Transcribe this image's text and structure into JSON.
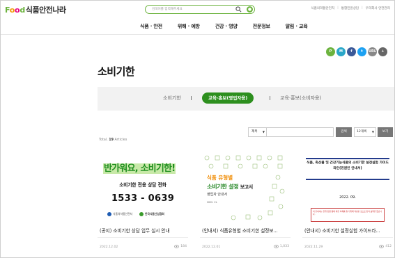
{
  "header": {
    "logo_food": "Food",
    "logo_site": "식품안전나라",
    "search_placeholder": "검색어를 입력해주세요",
    "top_links": [
      "식품의약품안전처",
      "통합민원상담",
      "우리회사 안전관리"
    ],
    "nav": [
      "식품 · 안전",
      "위해 · 예방",
      "건강 · 영양",
      "전문정보",
      "알림 · 교육"
    ]
  },
  "share": [
    "P",
    "M",
    "f",
    "t",
    "URL",
    "+"
  ],
  "page_title": "소비기한",
  "tabs": {
    "items": [
      "소비기한",
      "교육·홍보(영업자용)",
      "교육·홍보(소비자용)"
    ],
    "active_index": 1
  },
  "filter": {
    "type_selected": "제목",
    "search_button": "검색",
    "size_selected": "12개씩",
    "view_button": "보기"
  },
  "total": {
    "label": "Total",
    "count": "19",
    "unit": "Articles"
  },
  "cards": [
    {
      "thumb_banner": "반가워요, 소비기한!",
      "thumb_sub": "소비기한 전용 상담 전화",
      "thumb_phone": "1533 - 0639",
      "thumb_logo1": "식품의약품안전처",
      "thumb_logo2": "한국식품산업협회",
      "title": "(공지) 소비기한 상담 업무 실시 안내",
      "date": "2022.12.02",
      "views": "184"
    },
    {
      "thumb_line1": "식품 유형별",
      "thumb_line2": "소비기한 설정",
      "thumb_line2b": "보고서",
      "thumb_line3": "영업자 안내서",
      "thumb_line4": "2022. 11.",
      "title": "(안내서) 식품유형별 소비기한 설정보...",
      "date": "2022.12.01",
      "views": "1,033"
    },
    {
      "thumb_title": "식품, 축산물 및 건강기능식품의 소비기한 설정실험 가이드라인(민원인 안내서)",
      "thumb_year": "2022.  09.",
      "thumb_note": "이 안내서는 현행 법령 등에 대한 이해를 돕기 위해 작성된 것으로 법적 효력은 없습니다.",
      "title": "(안내서) 소비기한 설정실험 가이드라...",
      "date": "2022.11.29",
      "views": "412"
    }
  ],
  "colors": {
    "brand_green": "#6cb33e",
    "tab_active": "#2d8f1e",
    "button_gray": "#777777"
  }
}
